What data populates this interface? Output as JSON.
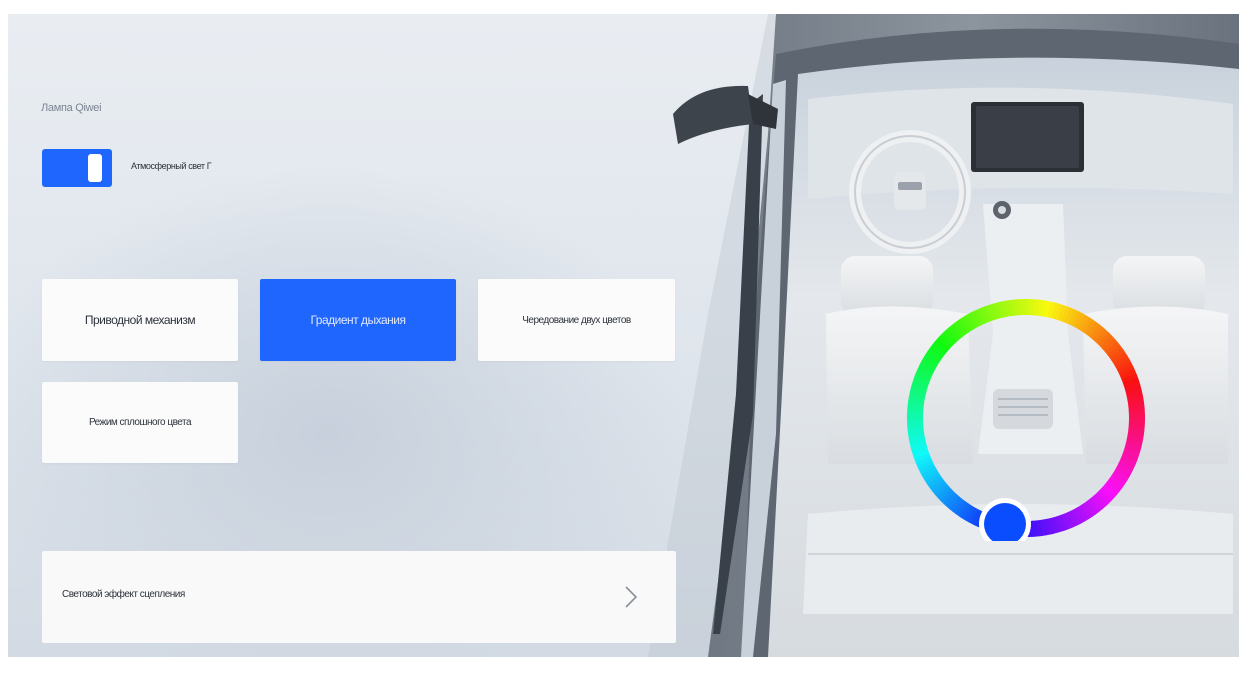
{
  "lighting": {
    "section_title": "Лампа Qiwei",
    "ambient_toggle": {
      "label": "Атмосферный свет Г",
      "on": true
    },
    "modes": [
      {
        "label": "Приводной механизм",
        "active": false
      },
      {
        "label": "Градиент дыхания",
        "active": true
      },
      {
        "label": "Чередование двух цветов",
        "active": false
      },
      {
        "label": "Режим сплошного цвета",
        "active": false
      }
    ],
    "clutch_effect": {
      "label": "Световой эффект сцепления",
      "icon": "chevron-right-icon"
    }
  },
  "color_picker": {
    "selected_color": "#0a4dff",
    "accent": "#1f66ff"
  }
}
